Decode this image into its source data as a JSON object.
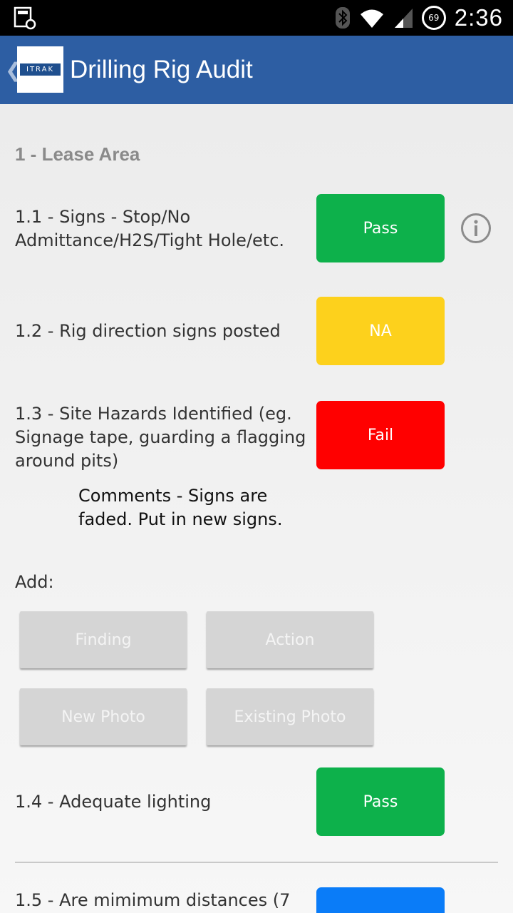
{
  "status_bar": {
    "time": "2:36",
    "battery": "69"
  },
  "app_bar": {
    "title": "Drilling Rig Audit",
    "logo_text": "ITRAK"
  },
  "section": {
    "title": "1 - Lease Area"
  },
  "questions": [
    {
      "label": "1.1 - Signs - Stop/No Admittance/H2S/Tight Hole/etc.",
      "status": "Pass"
    },
    {
      "label": "1.2 - Rig direction signs posted",
      "status": "NA"
    },
    {
      "label": "1.3 - Site Hazards Identified (eg. Signage tape, guarding a flagging around pits)",
      "status": "Fail",
      "comments": "Comments - Signs are faded. Put in new signs."
    },
    {
      "label": "1.4 - Adequate lighting",
      "status": "Pass"
    },
    {
      "label": "1.5 - Are mimimum distances (7",
      "status": ""
    }
  ],
  "add": {
    "label": "Add:",
    "finding": "Finding",
    "action": "Action",
    "new_photo": "New Photo",
    "existing_photo": "Existing Photo"
  },
  "colors": {
    "app_bar": "#2d5ea3",
    "pass": "#0db14b",
    "na": "#fdd11c",
    "fail": "#ff0000",
    "unanswered": "#0a7cf8"
  }
}
